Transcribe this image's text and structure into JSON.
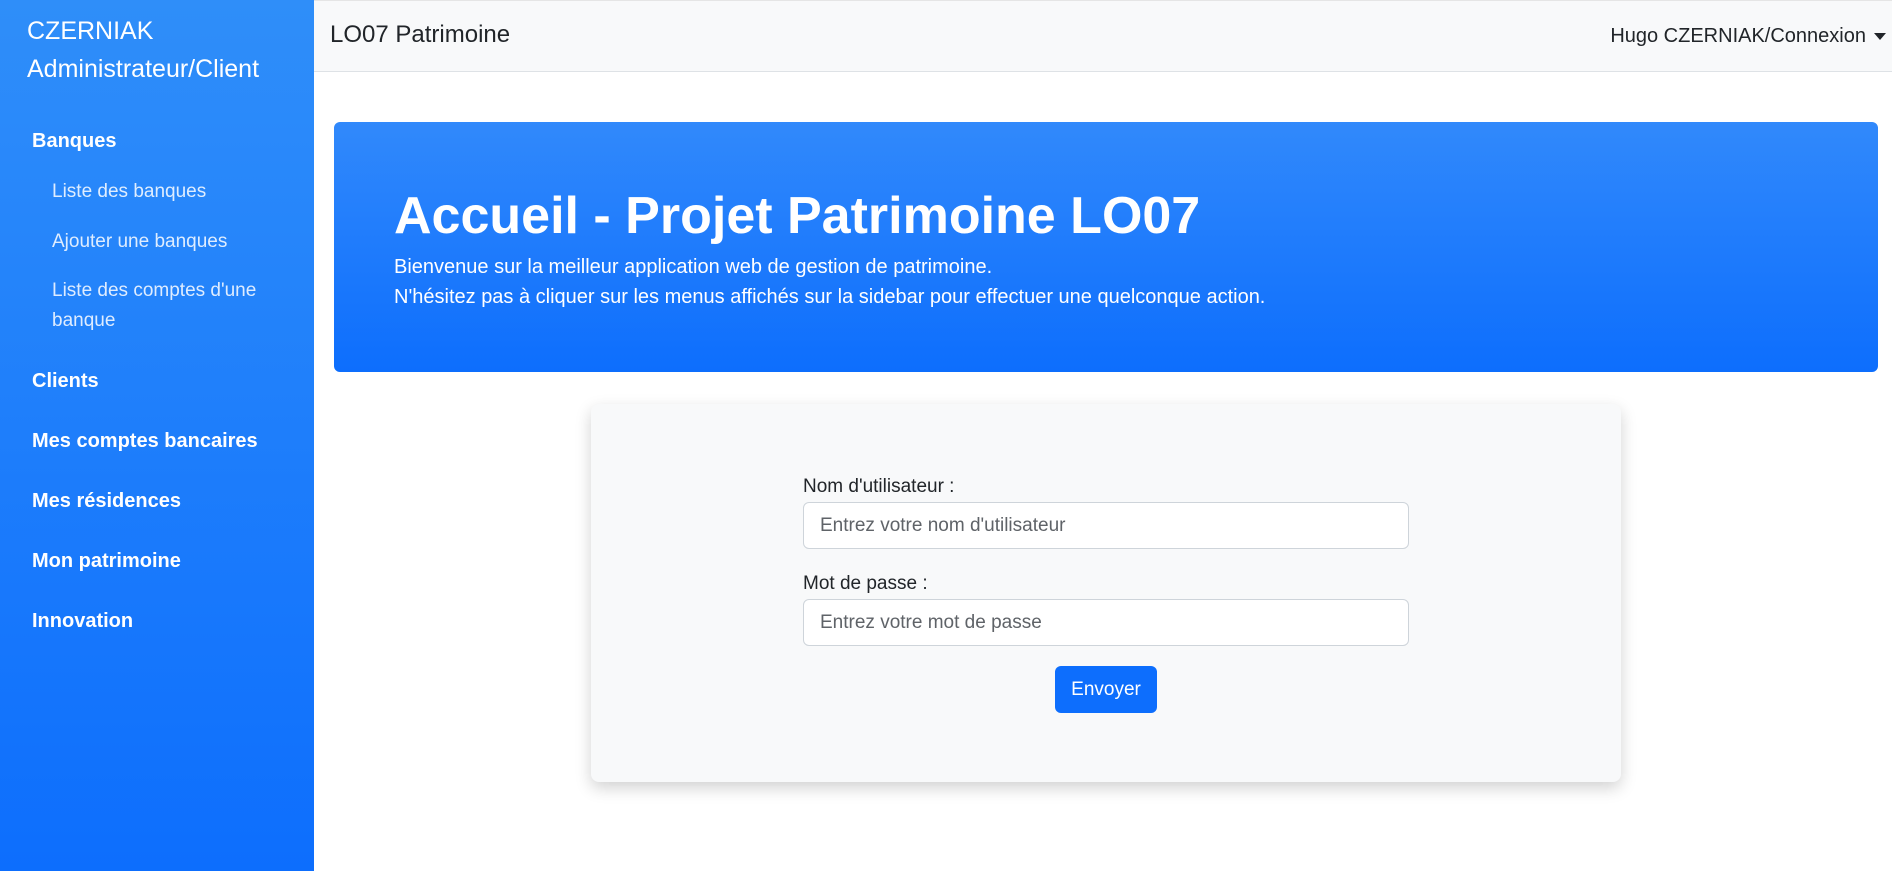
{
  "sidebar": {
    "brand": "CZERNIAK Administrateur/Client",
    "sections": {
      "banques": "Banques",
      "clients": "Clients",
      "comptes": "Mes comptes bancaires",
      "residences": "Mes résidences",
      "patrimoine": "Mon patrimoine",
      "innovation": "Innovation"
    },
    "banques_items": [
      "Liste des banques",
      "Ajouter une banques",
      "Liste des comptes d'une banque"
    ]
  },
  "navbar": {
    "brand": "LO07 Patrimoine",
    "user_menu": "Hugo CZERNIAK/Connexion",
    "user_menu_icon": "caret-down-icon"
  },
  "hero": {
    "title": "Accueil - Projet Patrimoine LO07",
    "line1": "Bienvenue sur la meilleur application web de gestion de patrimoine.",
    "line2": "N'hésitez pas à cliquer sur les menus affichés sur la sidebar pour effectuer une quelconque action."
  },
  "login": {
    "username_label": "Nom d'utilisateur :",
    "username_placeholder": "Entrez votre nom d'utilisateur",
    "password_label": "Mot de passe :",
    "password_placeholder": "Entrez votre mot de passe",
    "submit_label": "Envoyer"
  },
  "colors": {
    "primary": "#0d6efd",
    "navbar_bg": "#f8f9fa",
    "card_bg": "#f8f9fa"
  }
}
